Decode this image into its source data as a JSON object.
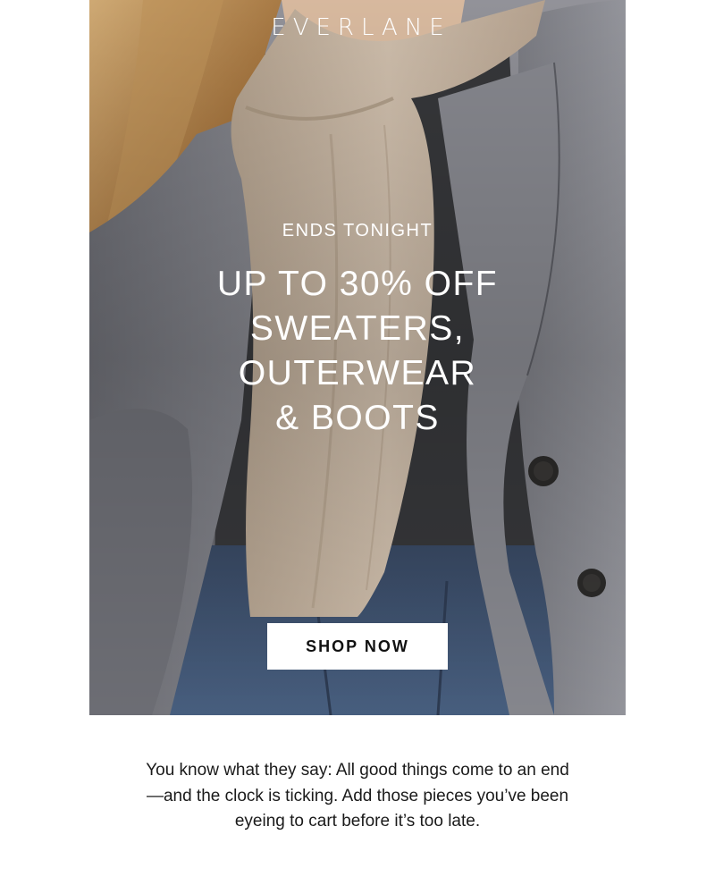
{
  "brand": {
    "logo_text": "EVERLANE"
  },
  "hero": {
    "eyebrow": "ENDS TONIGHT",
    "headline_lines": [
      "UP TO 30% OFF",
      "SWEATERS,",
      "OUTERWEAR",
      "& BOOTS"
    ],
    "cta_label": "SHOP NOW"
  },
  "body": {
    "lines": [
      "You know what they say: All good things come to an end",
      "—and the clock is ticking. Add those pieces you’ve been",
      "eyeing to cart before it’s too late."
    ]
  },
  "colors": {
    "page_background": "#ffffff",
    "hero_text": "#ffffff",
    "cta_background": "#ffffff",
    "cta_text": "#111111",
    "body_text": "#1a1a1a",
    "coat_gray": "#7c7d84",
    "scarf_beige": "#cdbba8",
    "denim_blue": "#3d5170",
    "hair_blonde": "#b98952"
  }
}
